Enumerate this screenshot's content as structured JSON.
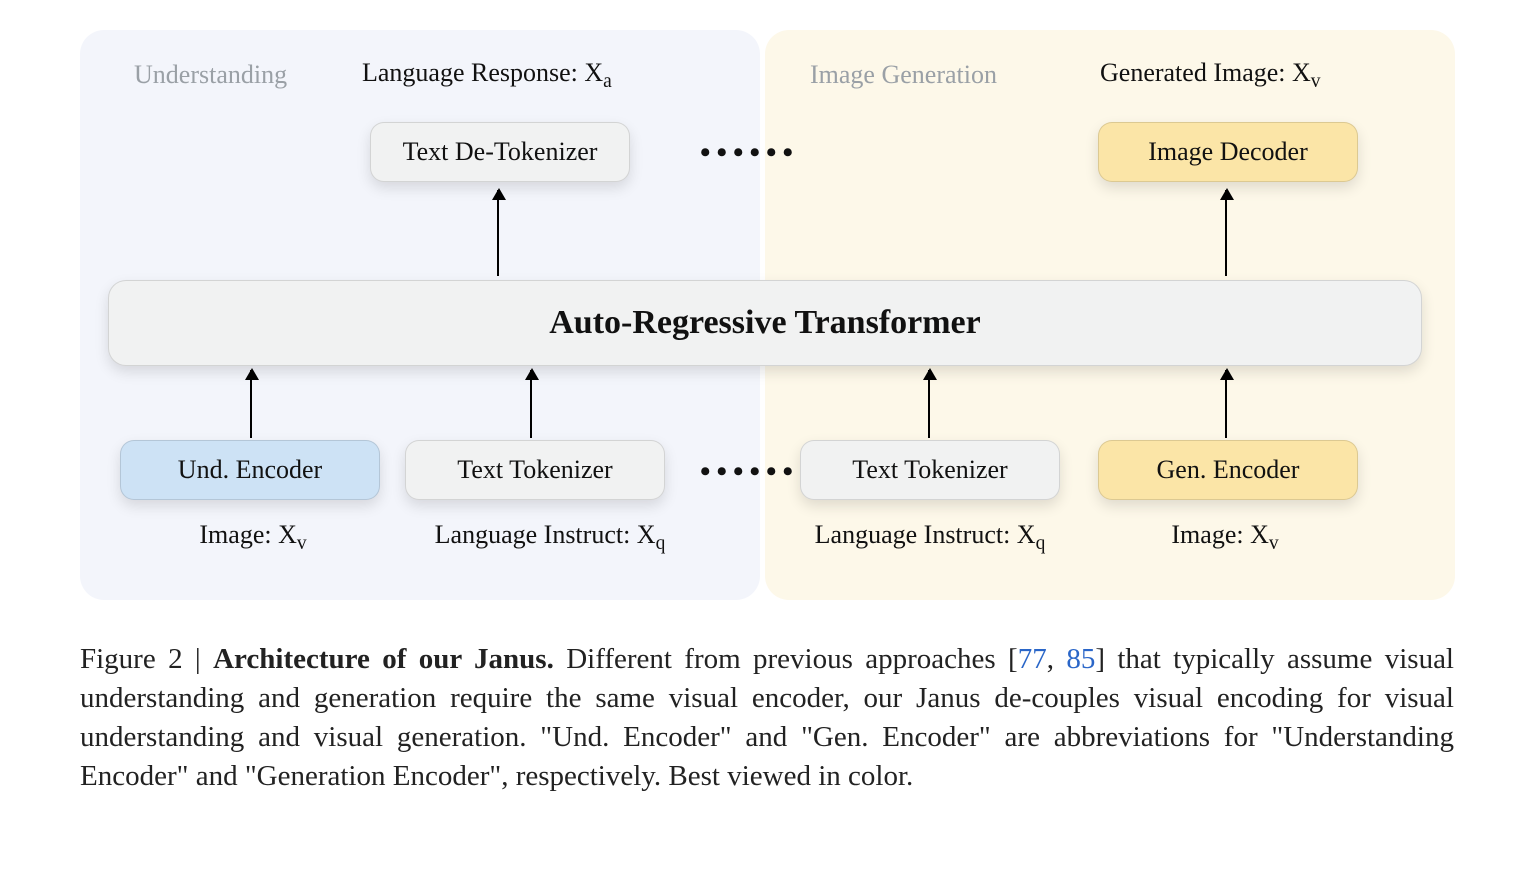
{
  "sections": {
    "left_title": "Understanding",
    "right_title": "Image Generation"
  },
  "outputs": {
    "left_label_prefix": "Language Response: X",
    "left_label_sub": "a",
    "right_label_prefix": "Generated Image: X",
    "right_label_sub": "v"
  },
  "blocks": {
    "text_detokenizer": "Text De-Tokenizer",
    "image_decoder": "Image Decoder",
    "transformer": "Auto-Regressive Transformer",
    "und_encoder": "Und. Encoder",
    "text_tokenizer": "Text Tokenizer",
    "gen_encoder": "Gen. Encoder"
  },
  "inputs": {
    "image_prefix": "Image: X",
    "image_sub": "v",
    "lang_prefix": "Language Instruct: X",
    "lang_sub": "q"
  },
  "dots": "••••••",
  "caption": {
    "figure_label": "Figure 2 | ",
    "title_bold": "Architecture of our Janus.",
    "body_1": " Different from previous approaches [",
    "ref1": "77",
    "ref_sep": ", ",
    "ref2": "85",
    "body_2": "] that typically assume visual understanding and generation require the same visual encoder, our Janus de-couples visual encoding for visual understanding and visual generation. \"Und. Encoder\" and \"Gen. Encoder\" are abbreviations for \"Understanding Encoder\" and \"Generation Encoder\", respectively. Best viewed in color."
  }
}
